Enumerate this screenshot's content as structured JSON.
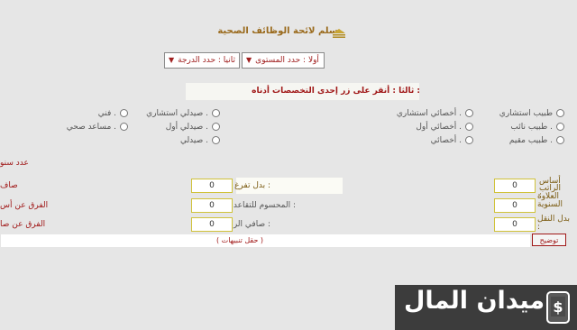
{
  "header": {
    "title": "سلم لائحة الوظائف الصحية .",
    "icon": "pyramid-icon"
  },
  "selects": {
    "level": "أولا : حدد المستوى",
    "grade": "ثانيا : حدد الدرجة"
  },
  "section3": {
    "label": "ثالثا : أنقر على زر إحدى التخصصات أدناه :"
  },
  "options": {
    "col1": [
      "طبيب استشاري",
      "طبيب نائب .",
      "طبيب مقيم ."
    ],
    "col2": [
      "أخصائي استشاري .",
      "أخصائي أول .",
      "أخصائي ."
    ],
    "col3": [
      "صيدلي استشاري .",
      "صيدلي أول .",
      "صيدلي ."
    ],
    "col4": [
      "فني .",
      "مساعد صحي ."
    ]
  },
  "form": {
    "years_label": "عدد سنو",
    "basic_label": "أساس الراتب :",
    "basic_value": "0",
    "annual_label": "العلاوة السنوية",
    "annual_value": "0",
    "transport_label": "بدل النقل :",
    "transport_value": "0",
    "dedication_label": "بدل تفرغ :",
    "dedication_value": "0",
    "pension_label": "المحسوم للتقاعد :",
    "pension_value": "0",
    "net_label": "صافي الراتب :",
    "net_value": "0",
    "left_label_1": "صاف",
    "left_label_2": "الفرق عن أس",
    "left_label_3": "الفرق عن صا"
  },
  "remarks": {
    "text": "( حقل تنبيهات )",
    "button": "توضيح"
  },
  "watermark": {
    "text": "ميدان المال",
    "icon": "dollar-phone-icon"
  }
}
